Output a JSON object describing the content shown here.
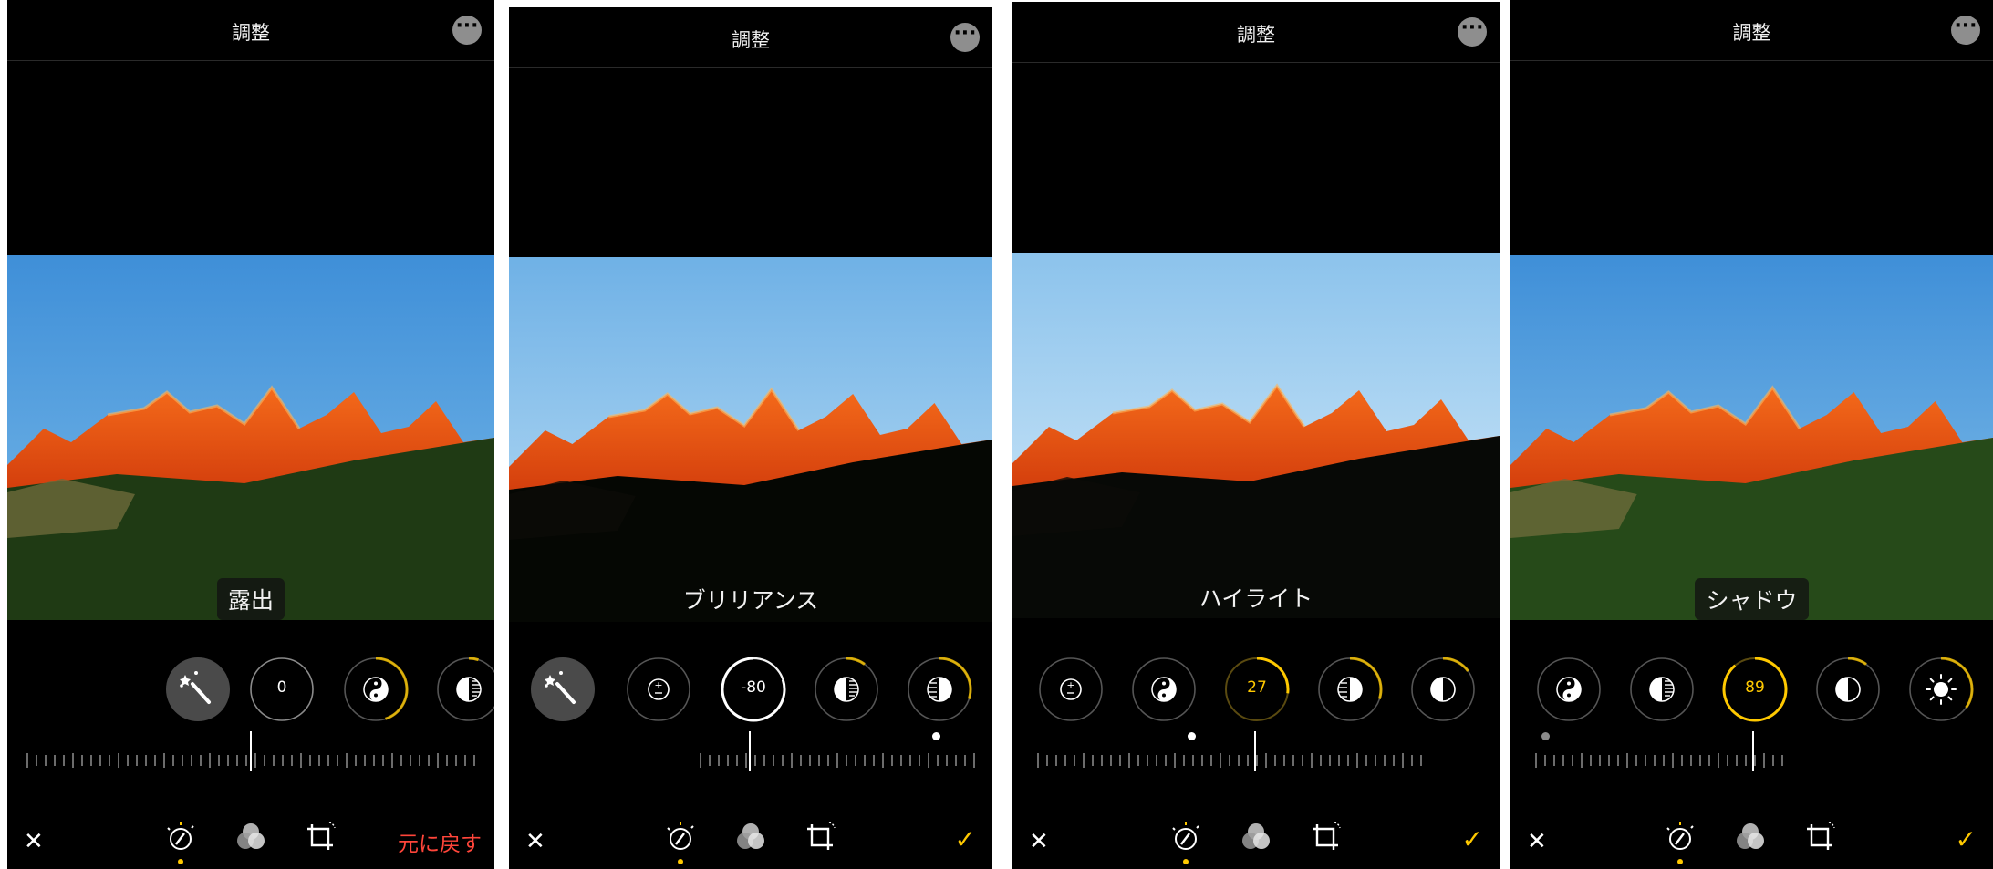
{
  "colors": {
    "accent": "#ffc900",
    "destructive": "#ff453a",
    "background": "#000000"
  },
  "screens": [
    {
      "title": "調整",
      "adjustment_label": "露出",
      "controls": [
        {
          "icon": "magic-wand-icon",
          "active": false
        },
        {
          "icon": "exposure-icon",
          "value": "0",
          "active": true
        },
        {
          "icon": "yin-yang-icon",
          "progress": 0.45,
          "active": false
        },
        {
          "icon": "highlights-icon",
          "progress": 0.05,
          "active": false
        }
      ],
      "slider_value": 0,
      "cancel": "✕",
      "action": "元に戻す",
      "tabs": [
        "adjust-icon",
        "filters-icon",
        "crop-icon"
      ]
    },
    {
      "title": "調整",
      "adjustment_label": "ブリリアンス",
      "controls": [
        {
          "icon": "magic-wand-icon",
          "active": false
        },
        {
          "icon": "exposure-icon",
          "active": false
        },
        {
          "icon": "brilliance-icon",
          "value": "-80",
          "progress": -0.8,
          "active": true
        },
        {
          "icon": "highlights-icon",
          "progress": 0.1,
          "active": false
        },
        {
          "icon": "shadows-icon",
          "progress": 0.3,
          "active": false
        }
      ],
      "slider_value": -80,
      "cancel": "✕",
      "action": "✓",
      "tabs": [
        "adjust-icon",
        "filters-icon",
        "crop-icon"
      ]
    },
    {
      "title": "調整",
      "adjustment_label": "ハイライト",
      "controls": [
        {
          "icon": "exposure-icon",
          "active": false
        },
        {
          "icon": "brilliance-icon",
          "active": false
        },
        {
          "icon": "highlights-icon",
          "value": "27",
          "progress": 0.27,
          "active": true
        },
        {
          "icon": "shadows-icon",
          "progress": 0.3,
          "active": false
        },
        {
          "icon": "contrast-icon",
          "progress": 0.15,
          "active": false
        }
      ],
      "slider_value": 27,
      "cancel": "✕",
      "action": "✓",
      "tabs": [
        "adjust-icon",
        "filters-icon",
        "crop-icon"
      ]
    },
    {
      "title": "調整",
      "adjustment_label": "シャドウ",
      "controls": [
        {
          "icon": "brilliance-icon",
          "active": false
        },
        {
          "icon": "highlights-icon",
          "active": false
        },
        {
          "icon": "shadows-icon",
          "value": "89",
          "progress": 0.89,
          "active": true
        },
        {
          "icon": "contrast-icon",
          "progress": 0.1,
          "active": false
        },
        {
          "icon": "brightness-icon",
          "progress": 0.35,
          "active": false
        }
      ],
      "slider_value": 89,
      "cancel": "✕",
      "action": "✓",
      "tabs": [
        "adjust-icon",
        "filters-icon",
        "crop-icon"
      ]
    }
  ]
}
